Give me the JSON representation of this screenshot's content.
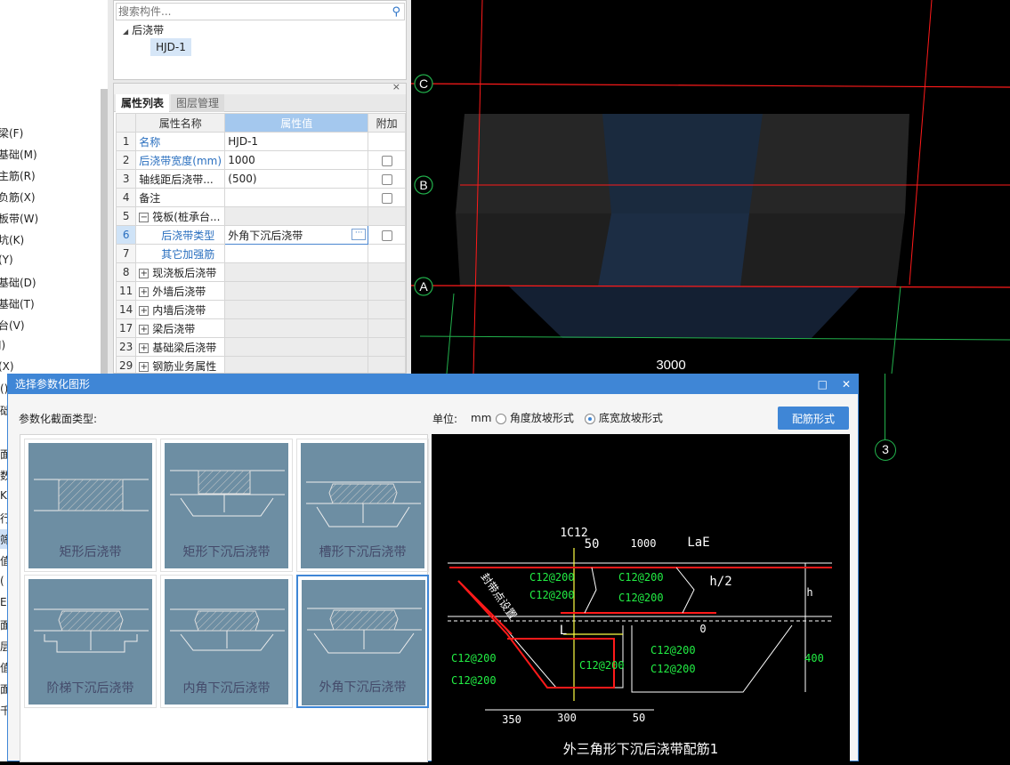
{
  "left_menu": {
    "items": [
      "梁(F)",
      "基础(M)",
      "主筋(R)",
      "负筋(X)",
      "板带(W)",
      "坑(K)",
      "(Y)",
      "基础(D)",
      "基础(T)",
      "台(V)",
      "J)",
      "(X)"
    ],
    "peek_items": [
      "()",
      "础",
      "面",
      "数",
      "K",
      "行",
      "筛",
      "值",
      "(",
      "E(",
      "面",
      "层",
      "值",
      "面",
      "千扌"
    ]
  },
  "component_tree": {
    "search_placeholder": "搜索构件...",
    "root": "后浇带",
    "leaf": "HJD-1"
  },
  "property_panel": {
    "tabs": [
      "属性列表",
      "图层管理"
    ],
    "headers": {
      "name": "属性名称",
      "value": "属性值",
      "extra": "附加"
    },
    "rows": [
      {
        "num": "1",
        "name": "名称",
        "value": "HJD-1"
      },
      {
        "num": "2",
        "name": "后浇带宽度(mm)",
        "value": "1000"
      },
      {
        "num": "3",
        "name": "轴线距后浇带...",
        "value": "(500)"
      },
      {
        "num": "4",
        "name": "备注",
        "value": ""
      },
      {
        "num": "5",
        "name": "筏板(桩承台...",
        "value": ""
      },
      {
        "num": "6",
        "name": "后浇带类型",
        "value": "外角下沉后浇带"
      },
      {
        "num": "7",
        "name": "其它加强筋",
        "value": ""
      },
      {
        "num": "8",
        "name": "现浇板后浇带",
        "value": ""
      },
      {
        "num": "11",
        "name": "外墙后浇带",
        "value": ""
      },
      {
        "num": "14",
        "name": "内墙后浇带",
        "value": ""
      },
      {
        "num": "17",
        "name": "梁后浇带",
        "value": ""
      },
      {
        "num": "23",
        "name": "基础梁后浇带",
        "value": ""
      },
      {
        "num": "29",
        "name": "钢筋业务属性",
        "value": ""
      }
    ]
  },
  "cad_view": {
    "axis_labels": [
      "C",
      "B",
      "A",
      "3"
    ],
    "dimension": "3000"
  },
  "dialog": {
    "title": "选择参数化图形",
    "section_label": "参数化截面类型:",
    "unit_label": "单位:",
    "unit": "mm",
    "radio_options": [
      "角度放坡形式",
      "底宽放坡形式"
    ],
    "selected_radio": 1,
    "rebar_button": "配筋形式",
    "shapes": [
      "矩形后浇带",
      "矩形下沉后浇带",
      "槽形下沉后浇带",
      "阶梯下沉后浇带",
      "内角下沉后浇带",
      "外角下沉后浇带"
    ],
    "selected_shape": 5
  },
  "preview": {
    "title": "外三角形下沉后浇带配筋1",
    "labels": {
      "top_bar": "1C12",
      "d50_top": "50",
      "d1000": "1000",
      "lae": "LaE",
      "h2": "h/2",
      "h": "h",
      "d400": "400",
      "zero": "0",
      "L": "L",
      "seal": "封带点设置",
      "d350": "350",
      "d300": "300",
      "d50_bottom": "50"
    },
    "rebar_labels": [
      "C12@200",
      "C12@200",
      "C12@200",
      "C12@200",
      "C12@200",
      "C12@200",
      "C12@200",
      "C12@200",
      "C12@200"
    ]
  },
  "colors": {
    "accent": "#3f86d6",
    "cad_red": "#ff1a1a",
    "cad_green": "#22b14c",
    "tile_bg": "#6d8ea3"
  }
}
